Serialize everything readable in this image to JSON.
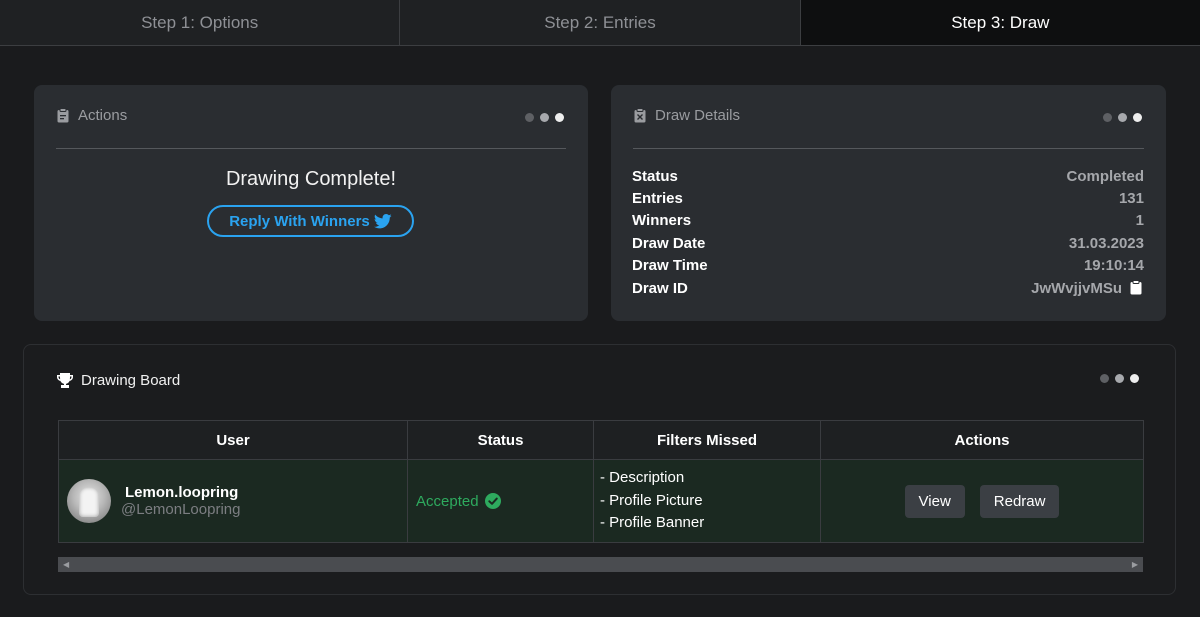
{
  "steps": [
    {
      "label": "Step 1: Options"
    },
    {
      "label": "Step 2: Entries"
    },
    {
      "label": "Step 3: Draw"
    }
  ],
  "actions_card": {
    "title": "Actions",
    "icon": "clipboard-icon",
    "complete_text": "Drawing Complete!",
    "reply_button": "Reply With Winners",
    "reply_icon": "twitter-icon"
  },
  "details_card": {
    "title": "Draw Details",
    "icon": "clipboard-x-icon",
    "rows": [
      {
        "label": "Status",
        "value": "Completed"
      },
      {
        "label": "Entries",
        "value": "131"
      },
      {
        "label": "Winners",
        "value": "1"
      },
      {
        "label": "Draw Date",
        "value": "31.03.2023"
      },
      {
        "label": "Draw Time",
        "value": "19:10:14"
      },
      {
        "label": "Draw ID",
        "value": "JwWvjjvMSu"
      }
    ]
  },
  "board": {
    "title": "Drawing Board",
    "icon": "trophy-icon",
    "columns": [
      "User",
      "Status",
      "Filters Missed",
      "Actions"
    ],
    "rows": [
      {
        "name": "Lemon.loopring",
        "handle": "@LemonLoopring",
        "status": "Accepted",
        "filters": [
          "- Description",
          "- Profile Picture",
          "- Profile Banner"
        ],
        "view_label": "View",
        "redraw_label": "Redraw"
      }
    ]
  },
  "colors": {
    "accent": "#2aa3f0",
    "accepted": "#2eaa5e",
    "card_bg": "#2a2d31",
    "page_bg": "#1a1b1d"
  }
}
